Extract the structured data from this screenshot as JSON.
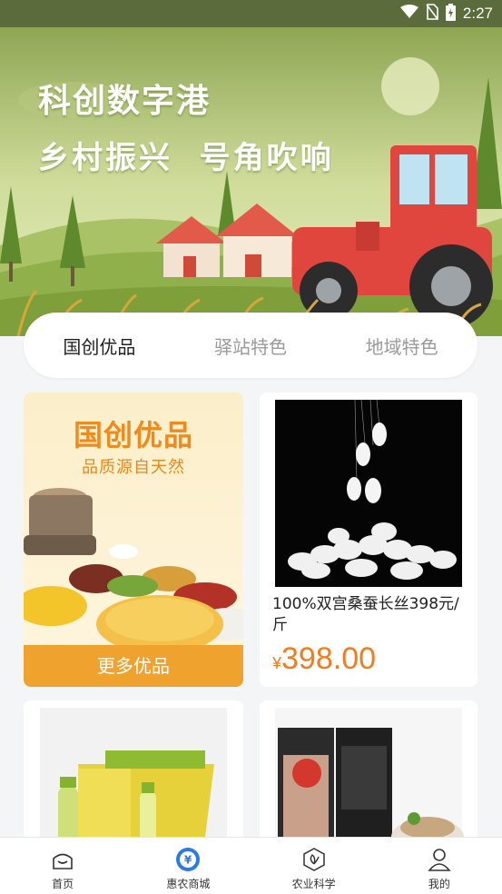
{
  "status_bar": {
    "time": "2:27",
    "icons": [
      "wifi-icon",
      "no-sim-icon",
      "battery-icon"
    ]
  },
  "banner": {
    "title": "科创数字港",
    "subtitle": "乡村振兴  号角吹响"
  },
  "tabs": [
    {
      "label": "国创优品",
      "active": true
    },
    {
      "label": "驿站特色",
      "active": false
    },
    {
      "label": "地域特色",
      "active": false
    }
  ],
  "promo": {
    "title": "国创优品",
    "subtitle": "品质源自天然",
    "button_label": "更多优品"
  },
  "products": [
    {
      "name": "100%双宫桑蚕长丝398元/斤",
      "currency": "¥",
      "price": "398.00"
    }
  ],
  "colors": {
    "accent_orange": "#f07d1f",
    "promo_button": "#f0a22e",
    "nav_active": "#2c7be5"
  },
  "nav": [
    {
      "label": "首页",
      "icon": "home-icon",
      "active": false
    },
    {
      "label": "惠农商城",
      "icon": "yuan-coin-icon",
      "active": true
    },
    {
      "label": "农业科学",
      "icon": "leaf-hexagon-icon",
      "active": false
    },
    {
      "label": "我的",
      "icon": "user-icon",
      "active": false
    }
  ]
}
